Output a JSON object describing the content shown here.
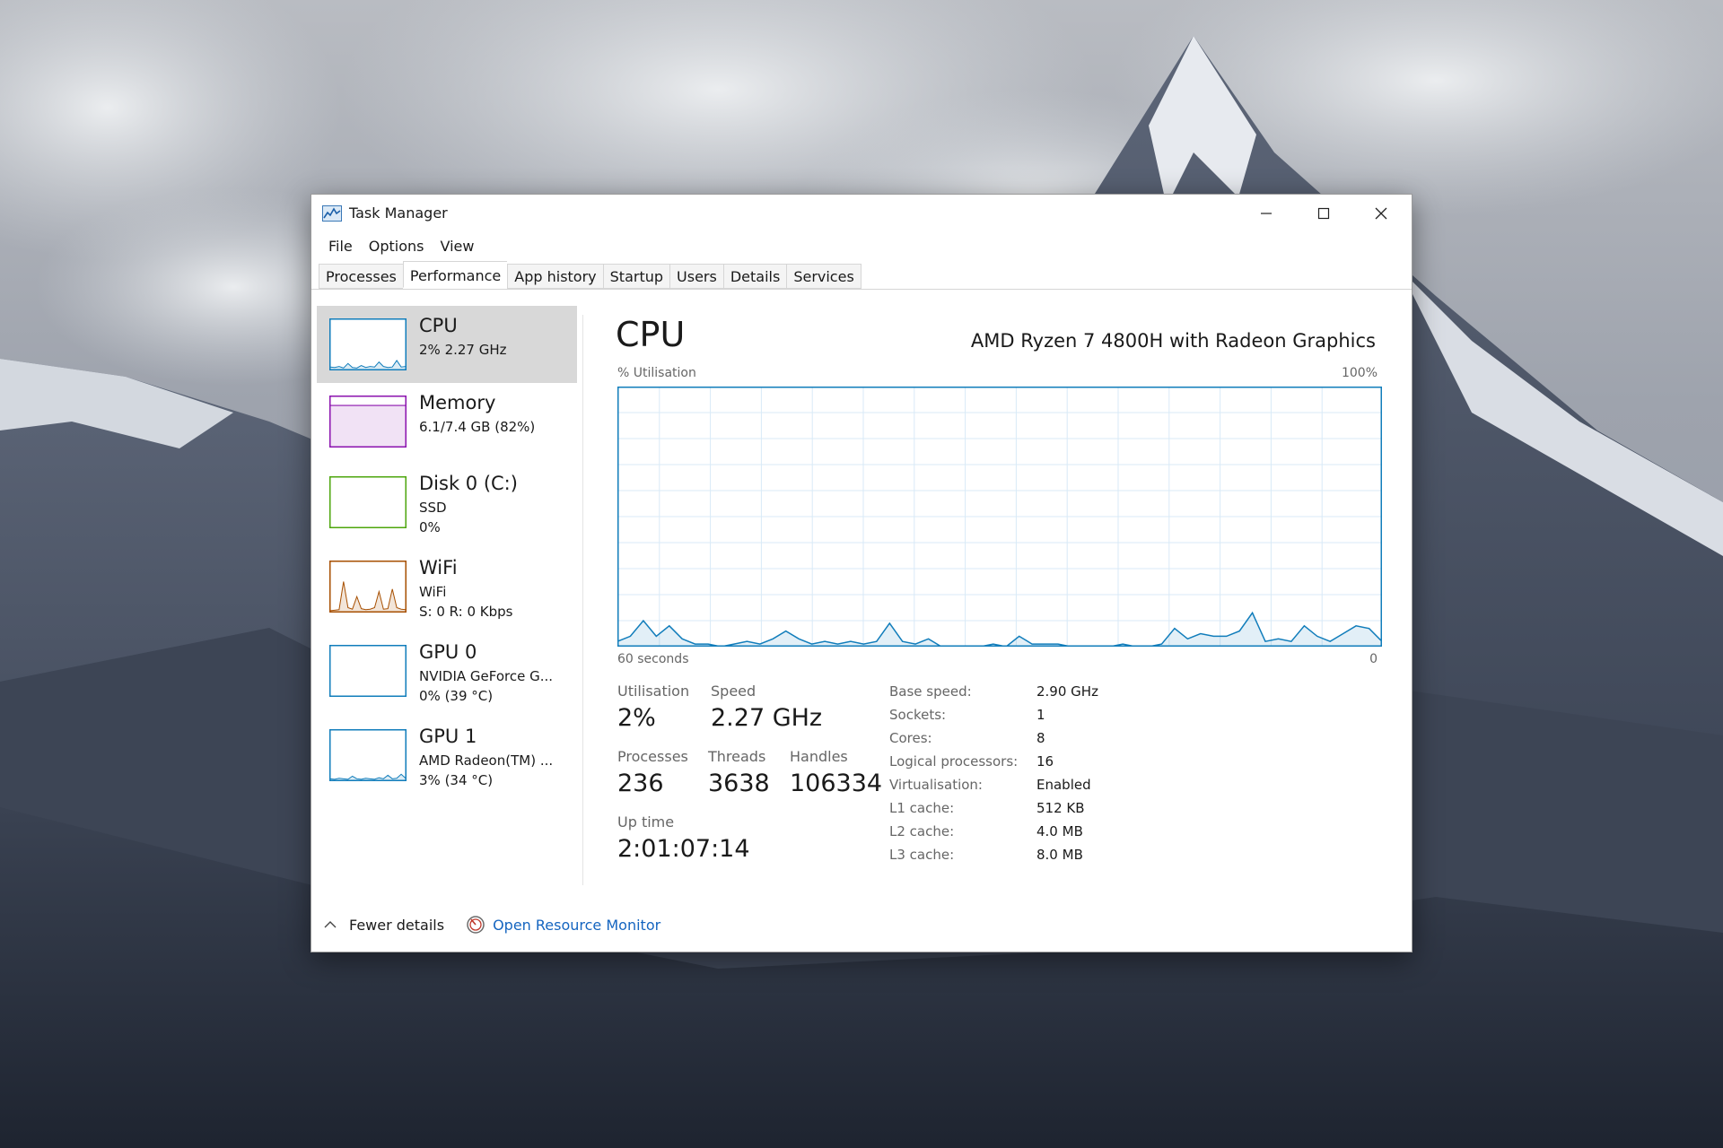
{
  "window": {
    "title": "Task Manager",
    "icon": "task-manager-icon",
    "controls": [
      "minimize-icon",
      "maximize-icon",
      "close-icon"
    ]
  },
  "menu": [
    "File",
    "Options",
    "View"
  ],
  "tabs": [
    {
      "label": "Processes",
      "active": false
    },
    {
      "label": "Performance",
      "active": true
    },
    {
      "label": "App history",
      "active": false
    },
    {
      "label": "Startup",
      "active": false
    },
    {
      "label": "Users",
      "active": false
    },
    {
      "label": "Details",
      "active": false
    },
    {
      "label": "Services",
      "active": false
    }
  ],
  "resources": [
    {
      "name": "CPU",
      "lines": [
        "2%  2.27 GHz"
      ],
      "color": "#117dbb",
      "selected": true,
      "spark": [
        5,
        4,
        6,
        3,
        12,
        4,
        3,
        8,
        4,
        6,
        5,
        15,
        6,
        4,
        5,
        18,
        5,
        6
      ]
    },
    {
      "name": "Memory",
      "lines": [
        "6.1/7.4 GB (82%)"
      ],
      "color": "#8b12ae",
      "selected": false,
      "fill_percent": 82
    },
    {
      "name": "Disk 0 (C:)",
      "lines": [
        "SSD",
        "0%"
      ],
      "color": "#4da60c",
      "selected": false,
      "spark": [
        0,
        0,
        0,
        0,
        0,
        0,
        0,
        0,
        0,
        0,
        0,
        0,
        0,
        0,
        0,
        0,
        0,
        0
      ]
    },
    {
      "name": "WiFi",
      "lines": [
        "WiFi",
        "S: 0  R: 0 Kbps"
      ],
      "color": "#a74f01",
      "selected": false,
      "spark": [
        2,
        3,
        4,
        60,
        8,
        5,
        30,
        6,
        4,
        5,
        8,
        40,
        5,
        6,
        45,
        8,
        5,
        4
      ]
    },
    {
      "name": "GPU 0",
      "lines": [
        "NVIDIA GeForce G...",
        "0%  (39 °C)"
      ],
      "color": "#117dbb",
      "selected": false,
      "spark": [
        0,
        0,
        0,
        0,
        0,
        0,
        0,
        0,
        0,
        0,
        0,
        0,
        0,
        0,
        0,
        0,
        0,
        0
      ]
    },
    {
      "name": "GPU 1",
      "lines": [
        "AMD Radeon(TM) ...",
        "3%  (34 °C)"
      ],
      "color": "#117dbb",
      "selected": false,
      "spark": [
        3,
        2,
        4,
        3,
        2,
        8,
        3,
        2,
        4,
        3,
        2,
        5,
        3,
        10,
        3,
        4,
        12,
        4
      ]
    }
  ],
  "detail": {
    "title": "CPU",
    "model": "AMD Ryzen 7 4800H with Radeon Graphics",
    "y_label": "% Utilisation",
    "y_max_label": "100%",
    "x_label": "60 seconds",
    "x_min_label": "0",
    "stats": {
      "utilisation_label": "Utilisation",
      "utilisation": "2%",
      "speed_label": "Speed",
      "speed": "2.27 GHz",
      "processes_label": "Processes",
      "processes": "236",
      "threads_label": "Threads",
      "threads": "3638",
      "handles_label": "Handles",
      "handles": "106334",
      "uptime_label": "Up time",
      "uptime": "2:01:07:14"
    },
    "specs": [
      {
        "label": "Base speed:",
        "value": "2.90 GHz"
      },
      {
        "label": "Sockets:",
        "value": "1"
      },
      {
        "label": "Cores:",
        "value": "8"
      },
      {
        "label": "Logical processors:",
        "value": "16"
      },
      {
        "label": "Virtualisation:",
        "value": "Enabled"
      },
      {
        "label": "L1 cache:",
        "value": "512 KB"
      },
      {
        "label": "L2 cache:",
        "value": "4.0 MB"
      },
      {
        "label": "L3 cache:",
        "value": "8.0 MB"
      }
    ]
  },
  "footer": {
    "fewer_details": "Fewer details",
    "open_resource_monitor": "Open Resource Monitor"
  },
  "chart_data": {
    "type": "area",
    "ylabel": "% Utilisation",
    "ylim": [
      0,
      100
    ],
    "x_span_seconds": 60,
    "grid": true,
    "series": [
      {
        "values": [
          2,
          4,
          10,
          4,
          8,
          3,
          1,
          1,
          0,
          1,
          2,
          1,
          3,
          6,
          3,
          1,
          2,
          1,
          2,
          1,
          2,
          9,
          2,
          1,
          3,
          0,
          0,
          0,
          0,
          1,
          0,
          4,
          1,
          1,
          1,
          0,
          0,
          0,
          0,
          1,
          0,
          0,
          1,
          7,
          3,
          5,
          4,
          4,
          6,
          13,
          2,
          3,
          2,
          8,
          4,
          2,
          5,
          8,
          7,
          2
        ]
      }
    ],
    "color": "#117dbb"
  }
}
